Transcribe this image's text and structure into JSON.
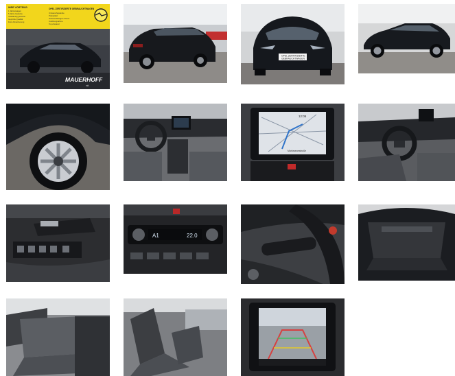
{
  "gallery": {
    "banner": {
      "left_title": "IHRE VORTEILE:",
      "left_items": [
        "1 Jahreswagen",
        "5 Jahre Garantie",
        "Vollständig gewartet",
        "Geprüfte Qualität",
        "Faire Finanzierung"
      ],
      "right_title": "OPEL ZERTIFIZIERTE GEBRAUCHTWAGEN",
      "right_items": [
        "Umtauschgarantie",
        "Probefahrt",
        "Gebrauchtwagen-Check",
        "Inzahlungnahme",
        "Top Zustand"
      ]
    },
    "dealer_name": "MAUERHOFF",
    "dealer_sub": "mit",
    "plate_line1": "OPEL ZERTIFIZIERTE",
    "plate_line2": "GEBRAUCHTWAGEN",
    "nav_time": "12:05",
    "nav_street": "Marloweamstraße",
    "climate_left": "A1",
    "climate_right": "22.0"
  },
  "colors": {
    "banner_yellow": "#f2d61c",
    "car_body": "#1b1f26",
    "floor": "#9a9a9a"
  }
}
